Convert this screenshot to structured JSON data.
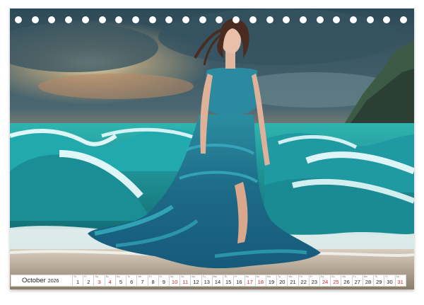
{
  "calendar": {
    "month": "October",
    "year": "2026",
    "day_names": [
      "Th",
      "Fr",
      "Sa",
      "Su",
      "Mo",
      "Tu",
      "We",
      "Th",
      "Fr",
      "Sa",
      "Su",
      "Mo",
      "Tu",
      "We",
      "Th",
      "Fr",
      "Sa",
      "Su",
      "Mo",
      "Tu",
      "We",
      "Th",
      "Fr",
      "Sa",
      "Su",
      "Mo",
      "Tu",
      "We",
      "Th",
      "Fr",
      "Sa"
    ],
    "days": [
      "1",
      "2",
      "3",
      "4",
      "5",
      "6",
      "7",
      "8",
      "9",
      "10",
      "11",
      "12",
      "13",
      "14",
      "15",
      "16",
      "17",
      "18",
      "19",
      "20",
      "21",
      "22",
      "23",
      "24",
      "25",
      "26",
      "27",
      "28",
      "29",
      "30",
      "31"
    ],
    "weekend_color": "#c62828"
  },
  "image": {
    "description_icon": "woman-wave-dress-image"
  }
}
